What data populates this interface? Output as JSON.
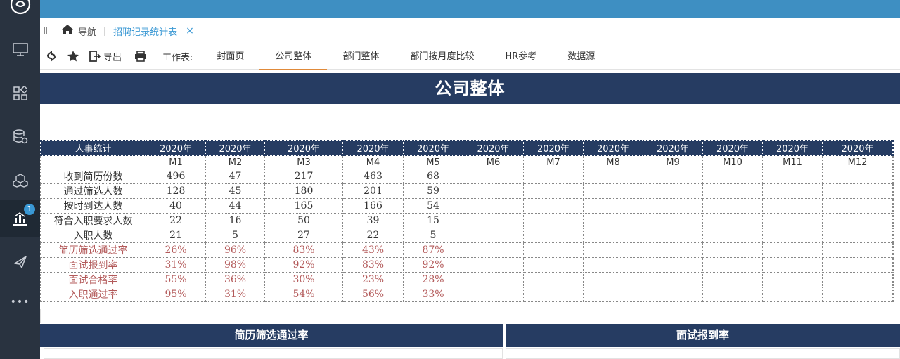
{
  "colors": {
    "nav_bg": "#293340",
    "topbar": "#3e8fc2",
    "accent": "#3a98d4",
    "header_navy": "#263c62",
    "rate_red": "#b35a5a",
    "active_underline": "#e08a3a"
  },
  "leftnav": {
    "items": [
      {
        "name": "monitor-icon"
      },
      {
        "name": "apps-icon"
      },
      {
        "name": "database-settings-icon"
      },
      {
        "name": "cubes-icon"
      },
      {
        "name": "chart-icon",
        "badge": "1"
      },
      {
        "name": "send-icon"
      },
      {
        "name": "more-icon",
        "label": "•••"
      }
    ]
  },
  "tabstrip": {
    "nav_label": "导航",
    "sep": "|",
    "active_tab": "招聘记录统计表",
    "close": "×"
  },
  "toolbar": {
    "export_label": "导出",
    "sheet_label": "工作表:",
    "sheets": [
      "封面页",
      "公司整体",
      "部门整体",
      "部门按月度比较",
      "HR参考",
      "数据源"
    ],
    "active_sheet_index": 1
  },
  "report": {
    "title": "公司整体",
    "table": {
      "header_label": "人事统计",
      "years": [
        "2020年",
        "2020年",
        "2020年",
        "2020年",
        "2020年",
        "2020年",
        "2020年",
        "2020年",
        "2020年",
        "2020年",
        "2020年",
        "2020年"
      ],
      "months": [
        "M1",
        "M2",
        "M3",
        "M4",
        "M5",
        "M6",
        "M7",
        "M8",
        "M9",
        "M10",
        "M11",
        "M12"
      ],
      "rows": [
        {
          "label": "收到简历份数",
          "values": [
            "496",
            "47",
            "217",
            "463",
            "68",
            "",
            "",
            "",
            "",
            "",
            "",
            ""
          ],
          "rate": false
        },
        {
          "label": "通过筛选人数",
          "values": [
            "128",
            "45",
            "180",
            "201",
            "59",
            "",
            "",
            "",
            "",
            "",
            "",
            ""
          ],
          "rate": false
        },
        {
          "label": "按时到达人数",
          "values": [
            "40",
            "44",
            "165",
            "166",
            "54",
            "",
            "",
            "",
            "",
            "",
            "",
            ""
          ],
          "rate": false
        },
        {
          "label": "符合入职要求人数",
          "values": [
            "22",
            "16",
            "50",
            "39",
            "15",
            "",
            "",
            "",
            "",
            "",
            "",
            ""
          ],
          "rate": false
        },
        {
          "label": "入职人数",
          "values": [
            "21",
            "5",
            "27",
            "22",
            "5",
            "",
            "",
            "",
            "",
            "",
            "",
            ""
          ],
          "rate": false
        },
        {
          "label": "简历筛选通过率",
          "values": [
            "26%",
            "96%",
            "83%",
            "43%",
            "87%",
            "",
            "",
            "",
            "",
            "",
            "",
            ""
          ],
          "rate": true
        },
        {
          "label": "面试报到率",
          "values": [
            "31%",
            "98%",
            "92%",
            "83%",
            "92%",
            "",
            "",
            "",
            "",
            "",
            "",
            ""
          ],
          "rate": true
        },
        {
          "label": "面试合格率",
          "values": [
            "55%",
            "36%",
            "30%",
            "23%",
            "28%",
            "",
            "",
            "",
            "",
            "",
            "",
            ""
          ],
          "rate": true
        },
        {
          "label": "入职通过率",
          "values": [
            "95%",
            "31%",
            "54%",
            "56%",
            "33%",
            "",
            "",
            "",
            "",
            "",
            "",
            ""
          ],
          "rate": true
        }
      ]
    },
    "charts": {
      "left_title": "简历筛选通过率",
      "right_title": "面试报到率"
    }
  }
}
